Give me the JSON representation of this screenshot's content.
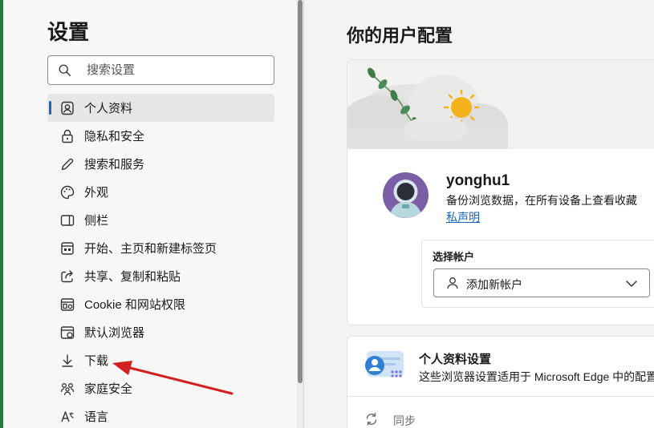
{
  "sidebar": {
    "title": "设置",
    "search": {
      "placeholder": "搜索设置",
      "value": ""
    },
    "items": [
      {
        "label": "个人资料",
        "icon": "profile-icon",
        "active": true
      },
      {
        "label": "隐私和安全",
        "icon": "lock-icon"
      },
      {
        "label": "搜索和服务",
        "icon": "pen-icon"
      },
      {
        "label": "外观",
        "icon": "palette-icon"
      },
      {
        "label": "侧栏",
        "icon": "sidebar-icon"
      },
      {
        "label": "开始、主页和新建标签页",
        "icon": "home-page-icon"
      },
      {
        "label": "共享、复制和粘贴",
        "icon": "share-icon"
      },
      {
        "label": "Cookie 和网站权限",
        "icon": "site-permissions-icon"
      },
      {
        "label": "默认浏览器",
        "icon": "browser-icon"
      },
      {
        "label": "下载",
        "icon": "download-icon"
      },
      {
        "label": "家庭安全",
        "icon": "family-icon"
      },
      {
        "label": "语言",
        "icon": "language-icon"
      }
    ]
  },
  "main": {
    "title": "你的用户配置",
    "profile": {
      "username": "yonghu1",
      "description": "备份浏览数据，在所有设备上查看收藏",
      "privacy_link": "私声明"
    },
    "account": {
      "label": "选择帐户",
      "select_value": "添加新帐户"
    },
    "profile_settings": {
      "title": "个人资料设置",
      "description": "这些浏览器设置适用于 Microsoft Edge 中的配置文"
    },
    "sync": {
      "label": "同步"
    }
  },
  "colors": {
    "accent": "#1565c0",
    "arrow": "#d32020",
    "window_edge": "#1e7b3a"
  }
}
